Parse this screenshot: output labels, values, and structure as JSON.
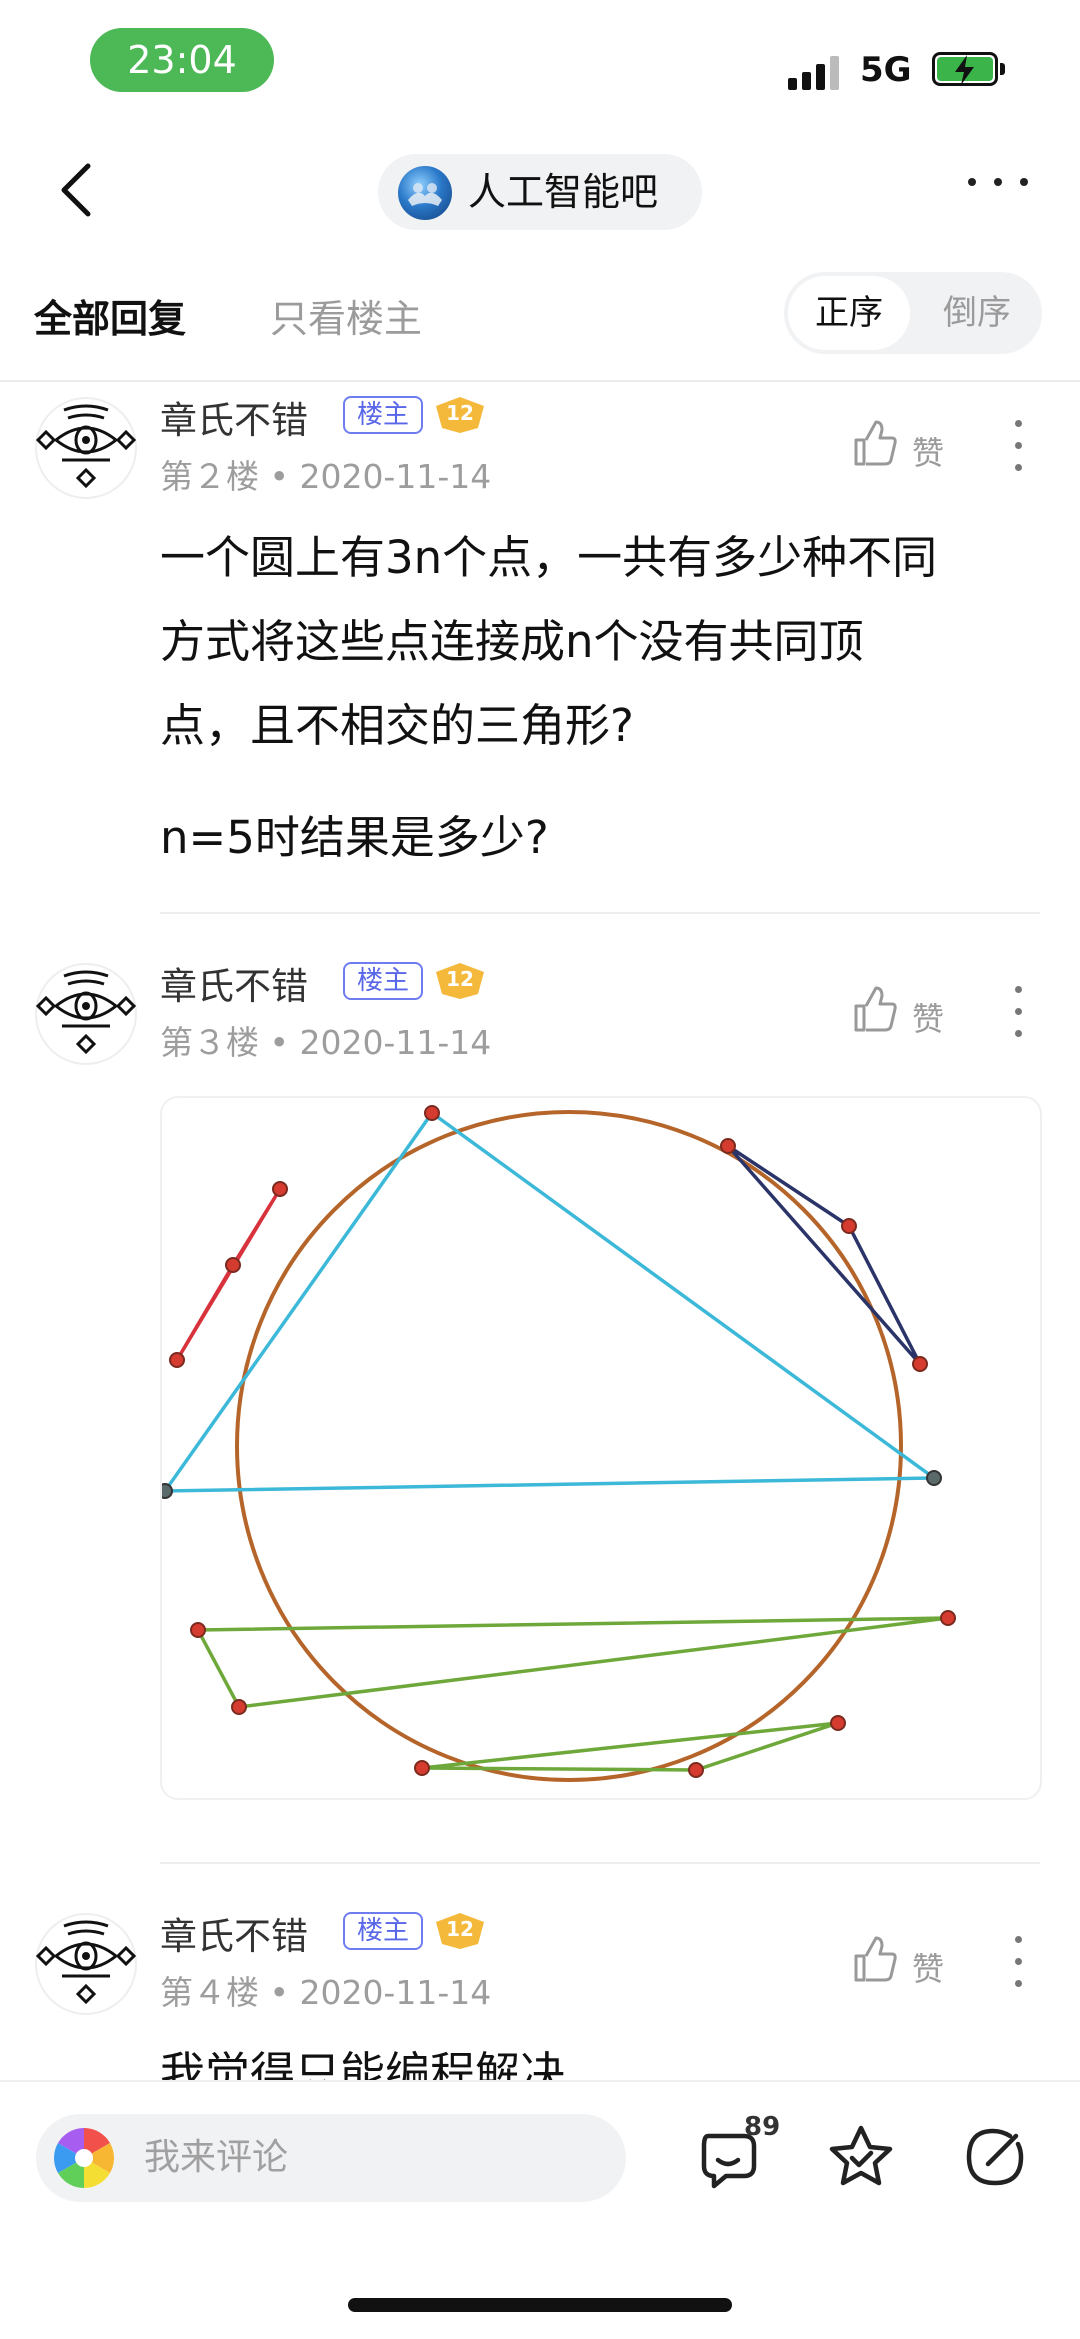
{
  "status_bar": {
    "time": "23:04",
    "network": "5G"
  },
  "nav": {
    "forum_name": "人工智能吧"
  },
  "filters": {
    "all_replies": "全部回复",
    "op_only": "只看楼主",
    "order_asc": "正序",
    "order_desc": "倒序"
  },
  "posts": [
    {
      "author": "章氏不错",
      "badge": "楼主",
      "level": "12",
      "floor": "第２楼",
      "date": "2020-11-14",
      "like_label": "赞",
      "lines": [
        "一个圆上有3n个点，一共有多少种不同",
        "方式将这些点连接成n个没有共同顶",
        "点，且不相交的三角形?",
        "n=5时结果是多少?"
      ]
    },
    {
      "author": "章氏不错",
      "badge": "楼主",
      "level": "12",
      "floor": "第３楼",
      "date": "2020-11-14",
      "like_label": "赞"
    },
    {
      "author": "章氏不错",
      "badge": "楼主",
      "level": "12",
      "floor": "第４楼",
      "date": "2020-11-14",
      "like_label": "赞",
      "lines": [
        "我觉得只能编程解决"
      ]
    }
  ],
  "bottom_bar": {
    "comment_placeholder": "我来评论",
    "reply_count": "89"
  },
  "colors": {
    "status_pill": "#4cb956",
    "circle": "#b5652a",
    "point": "#d63b2f",
    "tri_red": "#d8323c",
    "tri_blue": "#3cb8d8",
    "tri_navy": "#2a3468",
    "tri_green": "#6fa83a",
    "badge_lz": "#5866e8",
    "level_badge": "#f4b93a"
  }
}
